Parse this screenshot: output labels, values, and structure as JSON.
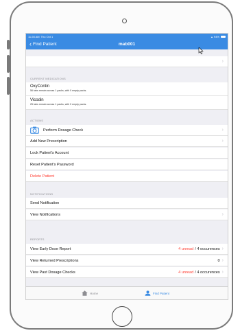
{
  "status": {
    "time": "11:28 AM",
    "day": "Thu Oct 1",
    "battery": "94%"
  },
  "nav": {
    "back_label": "Find Patient",
    "title": "mab001"
  },
  "sections": {
    "medications_header": "CURRENT MEDICATIONS",
    "actions_header": "ACTIONS",
    "notifications_header": "NOTIFICATIONS",
    "reports_header": "REPORTS"
  },
  "medications": [
    {
      "name": "OxyContin",
      "desc": "56 tabs remain across 1 packs, with 0 empty packs."
    },
    {
      "name": "Vicodin",
      "desc": "25 tabs remain across 1 packs, with 0 empty packs."
    }
  ],
  "actions": {
    "perform_dosage_check": "Perform Dosage Check",
    "add_new_prescription": "Add New Prescription",
    "lock_account": "Lock Patient's Account",
    "reset_password": "Reset Patient's Password",
    "delete_patient": "Delete Patient"
  },
  "notifications": {
    "send": "Send Notification",
    "view": "View Notifications"
  },
  "reports": {
    "early_dose": {
      "label": "View Early Dose Report",
      "unread": "4 unread",
      "occurences": "/ 4 occurences"
    },
    "returned": {
      "label": "View Returned Prescriptions",
      "count": "0"
    },
    "past_dosage": {
      "label": "View Past Dosage Checks",
      "unread": "4 unread",
      "occurences": "/ 4 occurences"
    }
  },
  "tabs": {
    "home": "Home",
    "find_patient": "Find Patient"
  },
  "colors": {
    "accent": "#3a8be3",
    "destructive": "#ff3b30",
    "background": "#efeff4"
  },
  "icons": [
    "chevron-left-icon",
    "wifi-icon",
    "battery-icon",
    "cursor-icon",
    "camera-icon",
    "chevron-right-icon",
    "home-icon",
    "find-patient-icon"
  ]
}
